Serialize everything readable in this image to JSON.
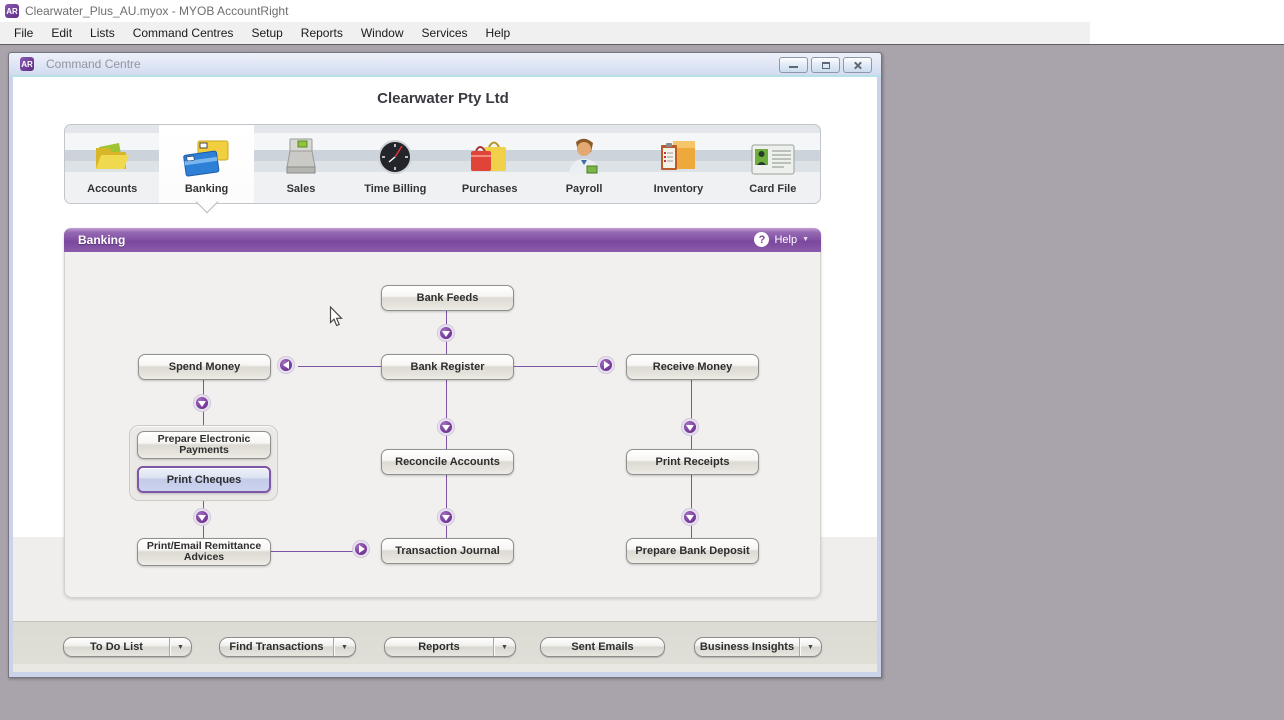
{
  "app_titlebar": {
    "title": "Clearwater_Plus_AU.myox - MYOB AccountRight",
    "icon_label": "AR"
  },
  "menubar": {
    "items": [
      "File",
      "Edit",
      "Lists",
      "Command Centres",
      "Setup",
      "Reports",
      "Window",
      "Services",
      "Help"
    ]
  },
  "window": {
    "title": "Command Centre",
    "icon_label": "AR",
    "company_name": "Clearwater Pty Ltd"
  },
  "modules": {
    "items": [
      {
        "label": "Accounts",
        "icon": "folder-icon",
        "selected": false
      },
      {
        "label": "Banking",
        "icon": "credit-cards-icon",
        "selected": true
      },
      {
        "label": "Sales",
        "icon": "cash-register-icon",
        "selected": false
      },
      {
        "label": "Time Billing",
        "icon": "clock-icon",
        "selected": false
      },
      {
        "label": "Purchases",
        "icon": "shopping-bags-icon",
        "selected": false
      },
      {
        "label": "Payroll",
        "icon": "payroll-person-icon",
        "selected": false
      },
      {
        "label": "Inventory",
        "icon": "inventory-box-icon",
        "selected": false
      },
      {
        "label": "Card File",
        "icon": "card-file-icon",
        "selected": false
      }
    ]
  },
  "panel": {
    "title": "Banking",
    "help": {
      "label": "Help",
      "icon": "?"
    }
  },
  "flowchart": {
    "nodes": [
      {
        "label": "Bank Feeds"
      },
      {
        "label": "Spend Money"
      },
      {
        "label": "Bank Register"
      },
      {
        "label": "Receive Money"
      },
      {
        "label": "Prepare Electronic Payments"
      },
      {
        "label": "Print Cheques",
        "highlighted": true
      },
      {
        "label": "Reconcile Accounts"
      },
      {
        "label": "Print Receipts"
      },
      {
        "label": "Print/Email Remittance Advices"
      },
      {
        "label": "Transaction Journal"
      },
      {
        "label": "Prepare Bank Deposit"
      }
    ]
  },
  "footer": {
    "buttons": [
      {
        "label": "To Do List",
        "dropdown": true
      },
      {
        "label": "Find Transactions",
        "dropdown": true
      },
      {
        "label": "Reports",
        "dropdown": true
      },
      {
        "label": "Sent Emails",
        "dropdown": false
      },
      {
        "label": "Business Insights",
        "dropdown": true
      }
    ]
  },
  "glyphs": {
    "dropdown_caret": "▼",
    "help_caret": "▼"
  },
  "colors": {
    "panel_header_purple": "#7d4a9c",
    "arrow_purple": "#7b3f9d",
    "highlight_fill": "#c7cdea",
    "mdi_background": "#a9a3ab"
  }
}
